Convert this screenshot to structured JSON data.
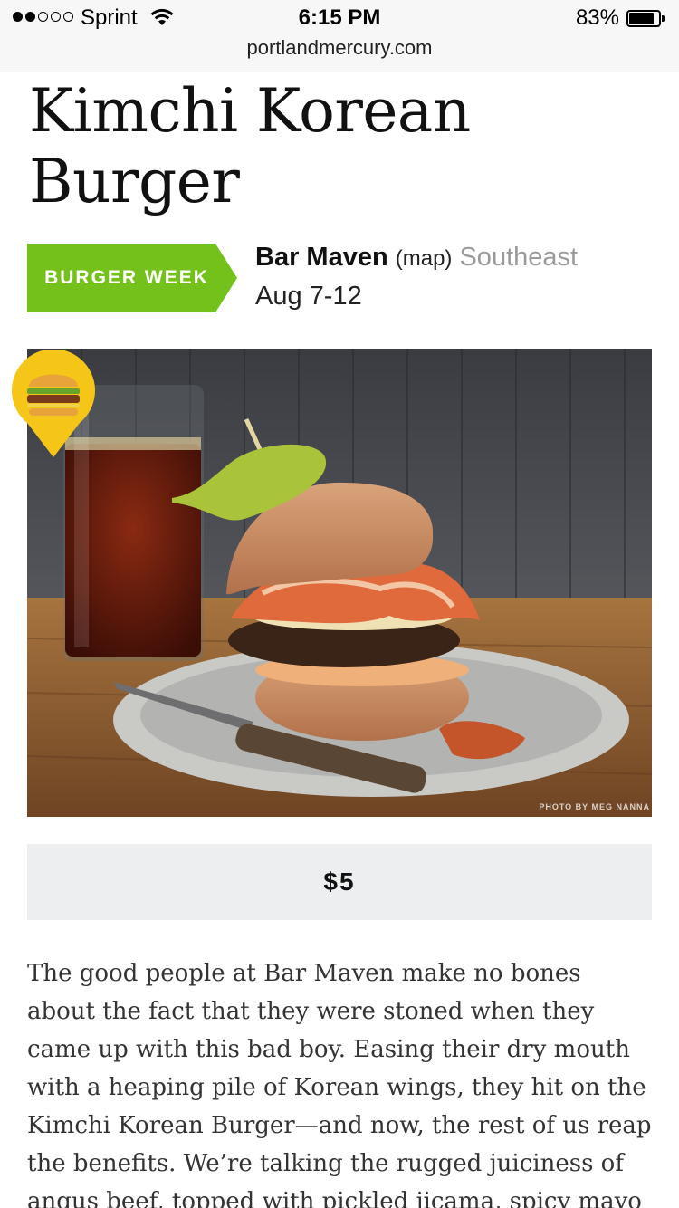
{
  "status_bar": {
    "carrier": "Sprint",
    "time": "6:15 PM",
    "battery_percent": "83%",
    "battery_level": 0.83,
    "signal_bars_filled": 2,
    "signal_bars_total": 5
  },
  "browser": {
    "url": "portlandmercury.com"
  },
  "article": {
    "title": "Kimchi Korean Burger",
    "tag": "BURGER WEEK",
    "tag_color": "#75c11c",
    "venue": "Bar Maven",
    "map_link": "(map)",
    "area": "Southeast",
    "dates": "Aug 7-12",
    "photo_credit": "PHOTO BY MEG NANNA",
    "price": "$5",
    "body": "The good people at Bar Maven make no bones about the fact that they were stoned when they came up with this bad boy. Easing their dry mouth with a heaping pile of Korean wings, they hit on the Kimchi Korean Burger—and now, the rest of us reap the benefits. We’re talking the rugged juiciness of angus beef, topped with pickled jicama, spicy mayo"
  },
  "icons": {
    "pin": "burger-pin-icon",
    "wifi": "wifi-icon",
    "battery": "battery-icon"
  }
}
